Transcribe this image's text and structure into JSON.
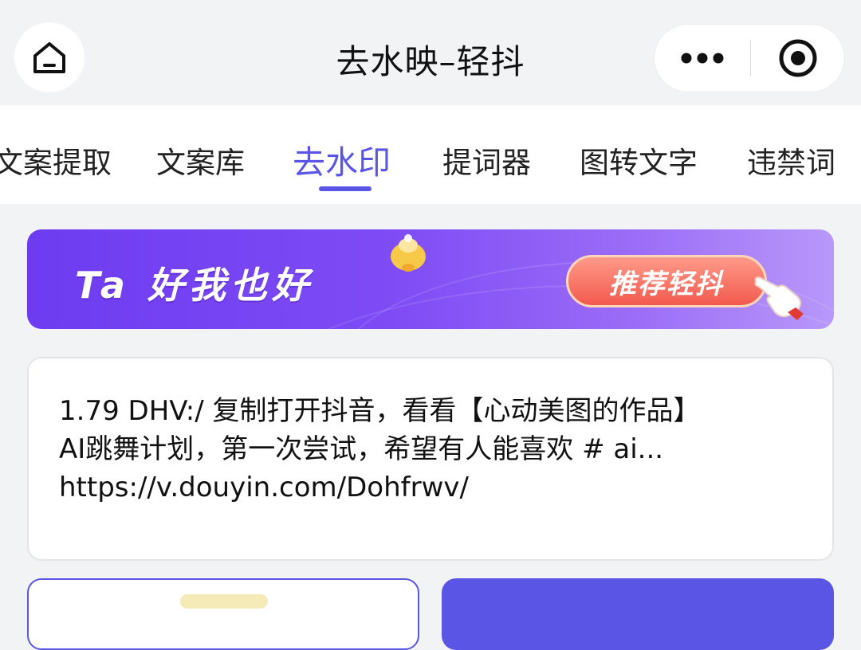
{
  "header": {
    "title": "去水映–轻抖",
    "home_icon": "home-icon",
    "more_icon": "more-dots-icon",
    "close_icon": "target-close-icon"
  },
  "tabs": [
    {
      "label": "文案提取",
      "active": false
    },
    {
      "label": "文案库",
      "active": false
    },
    {
      "label": "去水印",
      "active": true
    },
    {
      "label": "提词器",
      "active": false
    },
    {
      "label": "图转文字",
      "active": false
    },
    {
      "label": "违禁词",
      "active": false
    }
  ],
  "banner": {
    "slogan": "Ta 好我也好",
    "button_label": "推荐轻抖",
    "colors": {
      "start": "#6d3cf0",
      "end": "#b898fa",
      "button": "#f25a4e"
    }
  },
  "input": {
    "lines": [
      "1.79 DHV:/ 复制打开抖音，看看【心动美图的作品】",
      "AI跳舞计划，第一次尝试，希望有人能喜欢 # ai...",
      "https://v.douyin.com/Dohfrwv/"
    ]
  },
  "theme": {
    "accent": "#5b55e6"
  }
}
